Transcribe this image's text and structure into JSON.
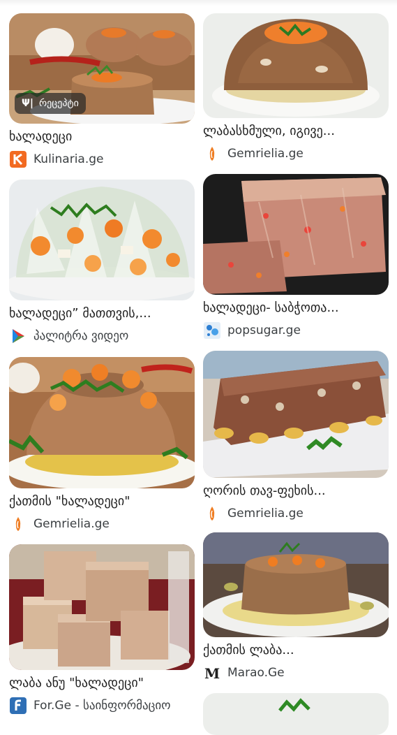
{
  "results": [
    {
      "title": "ხალადეცი",
      "source": "Kulinaria.ge",
      "icon": "kulinaria-logo-icon",
      "badge": "რეცეპტი"
    },
    {
      "title": "ლაბასხმული, იგივე...",
      "source": "Gemrielia.ge",
      "icon": "gemrielia-logo-icon"
    },
    {
      "title": "ხალადეცი” მათთვის,...",
      "source": "პალიტრა ვიდეო",
      "icon": "palitra-play-icon"
    },
    {
      "title": "ხალადეცი- საბჭოთა...",
      "source": "popsugar.ge",
      "icon": "popsugar-logo-icon"
    },
    {
      "title": "ქათმის \"ხალადეცი\"",
      "source": "Gemrielia.ge",
      "icon": "gemrielia-logo-icon"
    },
    {
      "title": "ღორის თავ-ფეხის...",
      "source": "Gemrielia.ge",
      "icon": "gemrielia-logo-icon"
    },
    {
      "title": "ლაბა ანუ \"ხალადეცი\"",
      "source": "For.Ge - საინფორმაციო",
      "icon": "forge-logo-icon"
    },
    {
      "title": "ქათმის ლაბა...",
      "source": "Marao.Ge",
      "icon": "marao-logo-icon"
    }
  ],
  "colors": {
    "kulinaria": "#f26a21",
    "gemrielia": "#ef7d22",
    "forge": "#2f6fb5",
    "text": "#1f1f1f"
  }
}
